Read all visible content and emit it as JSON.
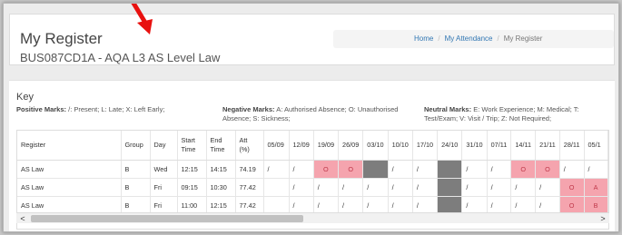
{
  "header": {
    "title": "My Register",
    "subtitle": "BUS087CD1A - AQA L3 AS Level Law",
    "breadcrumb": [
      {
        "label": "Home",
        "link": true
      },
      {
        "label": "My Attendance",
        "link": true
      },
      {
        "label": "My Register",
        "link": false
      }
    ],
    "accent_color": "#3277b3"
  },
  "annotation": {
    "icon": "red-arrow-icon",
    "color": "#e8110f"
  },
  "key": {
    "title": "Key",
    "positive": {
      "label": "Positive Marks:",
      "text": "/: Present; L: Late; X: Left Early;"
    },
    "negative": {
      "label": "Negative Marks:",
      "text": "A: Authorised Absence; O: Unauthorised Absence; S: Sickness;"
    },
    "neutral": {
      "label": "Neutral Marks:",
      "text": "E: Work Experience; M: Medical; T: Test/Exam; V: Visit / Trip; Z: Not Required;"
    }
  },
  "table": {
    "columns": [
      "Register",
      "Group",
      "Day",
      "Start Time",
      "End Time",
      "Att (%)"
    ],
    "dates": [
      "05/09",
      "12/09",
      "19/09",
      "26/09",
      "03/10",
      "10/10",
      "17/10",
      "24/10",
      "31/10",
      "07/11",
      "14/11",
      "21/11",
      "28/11",
      "05/1"
    ],
    "rows": [
      {
        "register": "AS Law",
        "group": "B",
        "day": "Wed",
        "start": "12:15",
        "end": "14:15",
        "att": "74.19",
        "marks": [
          "/",
          "/",
          "O",
          "O",
          "#",
          "/",
          "/",
          "#",
          "/",
          "/",
          "O",
          "O",
          "/",
          "/"
        ]
      },
      {
        "register": "AS Law",
        "group": "B",
        "day": "Fri",
        "start": "09:15",
        "end": "10:30",
        "att": "77.42",
        "marks": [
          "",
          "/",
          "/",
          "/",
          "/",
          "/",
          "/",
          "#",
          "/",
          "/",
          "/",
          "/",
          "O",
          "A"
        ]
      },
      {
        "register": "AS Law",
        "group": "B",
        "day": "Fri",
        "start": "11:00",
        "end": "12:15",
        "att": "77.42",
        "marks": [
          "",
          "/",
          "/",
          "/",
          "/",
          "/",
          "/",
          "#",
          "/",
          "/",
          "/",
          "/",
          "O",
          "B"
        ]
      }
    ],
    "negative_color": "#f5a4ae",
    "closed_color": "#7d7d7d"
  },
  "scrollbar": {
    "left_icon": "chevron-left-icon",
    "right_icon": "chevron-right-icon",
    "left_glyph": "<",
    "right_glyph": ">"
  }
}
